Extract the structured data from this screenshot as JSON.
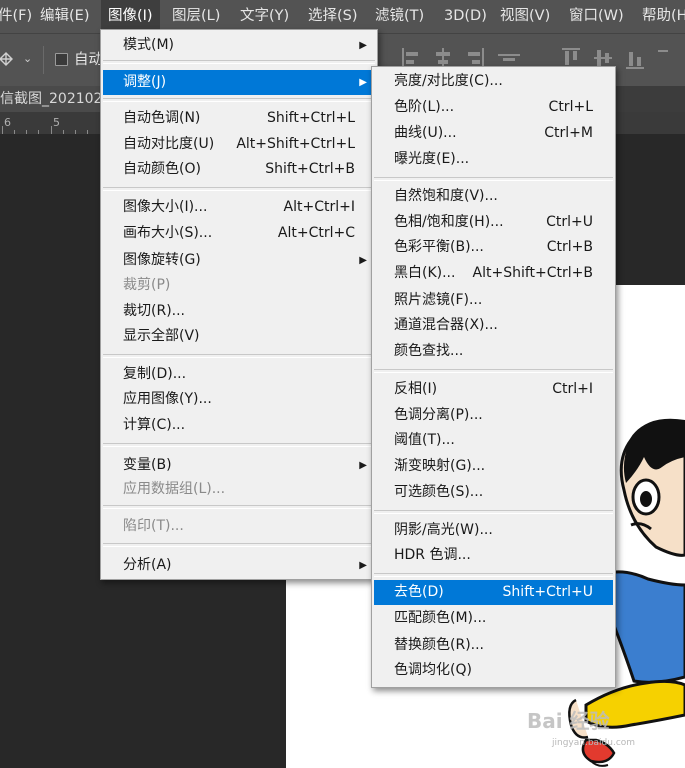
{
  "menubar": {
    "items": [
      {
        "label": "件(F)"
      },
      {
        "label": "编辑(E)"
      },
      {
        "label": "图像(I)"
      },
      {
        "label": "图层(L)"
      },
      {
        "label": "文字(Y)"
      },
      {
        "label": "选择(S)"
      },
      {
        "label": "滤镜(T)"
      },
      {
        "label": "3D(D)"
      },
      {
        "label": "视图(V)"
      },
      {
        "label": "窗口(W)"
      },
      {
        "label": "帮助(H"
      }
    ]
  },
  "options": {
    "auto_label": "自动"
  },
  "tab": {
    "title": "信截图_202102"
  },
  "ruler": {
    "nums": [
      "6",
      "5"
    ]
  },
  "image_menu": {
    "items": [
      {
        "label": "模式(M)",
        "shortcut": ""
      },
      {
        "label": "调整(J)",
        "shortcut": ""
      },
      {
        "label": "自动色调(N)",
        "shortcut": "Shift+Ctrl+L"
      },
      {
        "label": "自动对比度(U)",
        "shortcut": "Alt+Shift+Ctrl+L"
      },
      {
        "label": "自动颜色(O)",
        "shortcut": "Shift+Ctrl+B"
      },
      {
        "label": "图像大小(I)...",
        "shortcut": "Alt+Ctrl+I"
      },
      {
        "label": "画布大小(S)...",
        "shortcut": "Alt+Ctrl+C"
      },
      {
        "label": "图像旋转(G)",
        "shortcut": ""
      },
      {
        "label": "裁剪(P)",
        "shortcut": ""
      },
      {
        "label": "裁切(R)...",
        "shortcut": ""
      },
      {
        "label": "显示全部(V)",
        "shortcut": ""
      },
      {
        "label": "复制(D)...",
        "shortcut": ""
      },
      {
        "label": "应用图像(Y)...",
        "shortcut": ""
      },
      {
        "label": "计算(C)...",
        "shortcut": ""
      },
      {
        "label": "变量(B)",
        "shortcut": ""
      },
      {
        "label": "应用数据组(L)...",
        "shortcut": ""
      },
      {
        "label": "陷印(T)...",
        "shortcut": ""
      },
      {
        "label": "分析(A)",
        "shortcut": ""
      }
    ]
  },
  "adjust_menu": {
    "items": [
      {
        "label": "亮度/对比度(C)...",
        "shortcut": ""
      },
      {
        "label": "色阶(L)...",
        "shortcut": "Ctrl+L"
      },
      {
        "label": "曲线(U)...",
        "shortcut": "Ctrl+M"
      },
      {
        "label": "曝光度(E)...",
        "shortcut": ""
      },
      {
        "label": "自然饱和度(V)...",
        "shortcut": ""
      },
      {
        "label": "色相/饱和度(H)...",
        "shortcut": "Ctrl+U"
      },
      {
        "label": "色彩平衡(B)...",
        "shortcut": "Ctrl+B"
      },
      {
        "label": "黑白(K)...",
        "shortcut": "Alt+Shift+Ctrl+B"
      },
      {
        "label": "照片滤镜(F)...",
        "shortcut": ""
      },
      {
        "label": "通道混合器(X)...",
        "shortcut": ""
      },
      {
        "label": "颜色查找...",
        "shortcut": ""
      },
      {
        "label": "反相(I)",
        "shortcut": "Ctrl+I"
      },
      {
        "label": "色调分离(P)...",
        "shortcut": ""
      },
      {
        "label": "阈值(T)...",
        "shortcut": ""
      },
      {
        "label": "渐变映射(G)...",
        "shortcut": ""
      },
      {
        "label": "可选颜色(S)...",
        "shortcut": ""
      },
      {
        "label": "阴影/高光(W)...",
        "shortcut": ""
      },
      {
        "label": "HDR 色调...",
        "shortcut": ""
      },
      {
        "label": "去色(D)",
        "shortcut": "Shift+Ctrl+U"
      },
      {
        "label": "匹配颜色(M)...",
        "shortcut": ""
      },
      {
        "label": "替换颜色(R)...",
        "shortcut": ""
      },
      {
        "label": "色调均化(Q)",
        "shortcut": ""
      }
    ]
  },
  "watermark": {
    "text": "Bai 经验",
    "sub": "jingyan.baidu.com"
  },
  "colors": {
    "menu_bg": "#f0f0f0",
    "highlight": "#0078d7",
    "menubar_bg": "#535353",
    "canvas_bg": "#282828",
    "cartoon_shirt": "#3b7ecf",
    "cartoon_shorts": "#f6d100"
  }
}
